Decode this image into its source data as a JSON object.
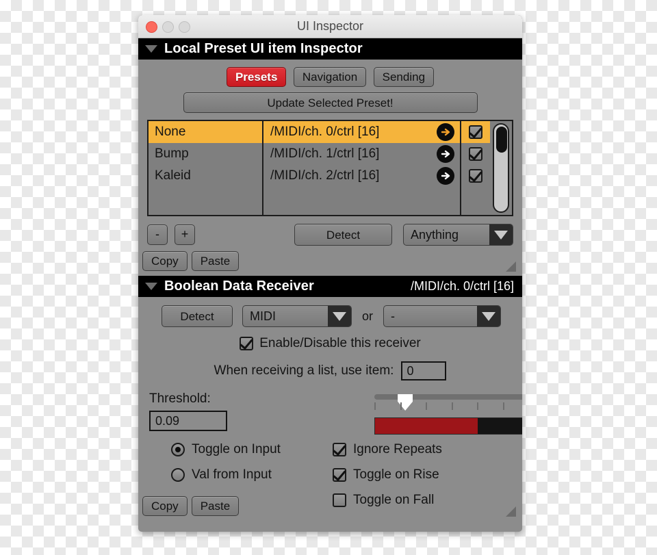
{
  "window": {
    "title": "UI Inspector",
    "traffic": {
      "close": "close-button",
      "minimize": "minimize-button",
      "maximize": "maximize-button"
    }
  },
  "preset_section": {
    "header_title": "Local Preset UI item Inspector",
    "tabs": [
      {
        "label": "Presets",
        "active": true
      },
      {
        "label": "Navigation",
        "active": false
      },
      {
        "label": "Sending",
        "active": false
      }
    ],
    "update_button": "Update Selected Preset!",
    "table": {
      "rows": [
        {
          "name": "None",
          "address": "/MIDI/ch. 0/ctrl [16]",
          "checked": true,
          "selected": true
        },
        {
          "name": "Bump",
          "address": "/MIDI/ch. 1/ctrl [16]",
          "checked": true,
          "selected": false
        },
        {
          "name": "Kaleid",
          "address": "/MIDI/ch. 2/ctrl [16]",
          "checked": true,
          "selected": false
        }
      ]
    },
    "remove_button": "-",
    "add_button": "+",
    "detect_button": "Detect",
    "filter_dropdown": "Anything",
    "copy_button": "Copy",
    "paste_button": "Paste"
  },
  "receiver_section": {
    "header_title": "Boolean Data Receiver",
    "header_address": "/MIDI/ch. 0/ctrl [16]",
    "detect_button": "Detect",
    "source_dropdown": "MIDI",
    "or_label": "or",
    "alt_dropdown": "-",
    "enable_label": "Enable/Disable this receiver",
    "enable_checked": true,
    "list_item_label": "When receiving a list, use item:",
    "list_item_value": "0",
    "threshold_label": "Threshold:",
    "threshold_value": "0.09",
    "slider_position_pct": 12,
    "meter_fill_pct": 40,
    "tick_count": 11,
    "options_left": [
      {
        "label": "Toggle on Input",
        "type": "radio",
        "on": true
      },
      {
        "label": "Val from Input",
        "type": "radio",
        "on": false
      }
    ],
    "options_right": [
      {
        "label": "Ignore Repeats",
        "type": "check",
        "on": true
      },
      {
        "label": "Toggle on Rise",
        "type": "check",
        "on": true
      },
      {
        "label": "Toggle on Fall",
        "type": "check",
        "on": false
      }
    ],
    "copy_button": "Copy",
    "paste_button": "Paste"
  },
  "colors": {
    "selection": "#f5b43c",
    "accent_red": "#ca1a21",
    "meter_red": "#9d1519",
    "panel": "#8c8c8c",
    "header_bg": "#000000"
  }
}
